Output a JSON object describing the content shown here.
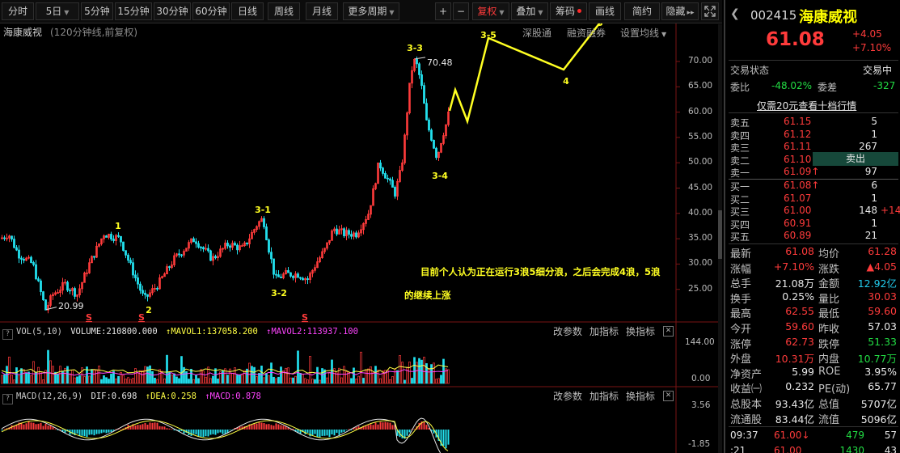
{
  "toolbar": {
    "tabs": [
      "分时",
      "5日",
      "5分钟",
      "15分钟",
      "30分钟",
      "60分钟",
      "日线",
      "周线",
      "月线",
      "更多周期"
    ],
    "plus": "+",
    "minus": "−",
    "fuquan": "复权",
    "diejia": "叠加",
    "chouma": "筹码",
    "huaxian": "画线",
    "jianyue": "简约",
    "yincang": "隐藏"
  },
  "chart": {
    "stock_name": "海康威视",
    "period_label": "(120分钟线,前复权)",
    "links": [
      "深股通",
      "融资融券",
      "设置均线"
    ],
    "price_ticks": [
      "70.00",
      "65.00",
      "60.00",
      "55.00",
      "50.00",
      "45.00",
      "40.00",
      "35.00",
      "30.00",
      "25.00"
    ],
    "high_label": "70.48",
    "low_label": "20.99",
    "wave_labels": [
      "1",
      "2",
      "3-1",
      "3-2",
      "3-3",
      "3-4",
      "3-5",
      "4",
      "5"
    ],
    "s_markers": [
      "S",
      "S",
      "S"
    ],
    "annotation_line1": "目前个人认为正在运行3浪5细分浪，之后会完成4浪，5浪",
    "annotation_line2": "的继续上涨"
  },
  "volume": {
    "legend_name": "VOL(5,10)",
    "volume": "VOLUME:210800.000",
    "mavol1": "MAVOL1:137058.200",
    "mavol2": "MAVOL2:113937.100",
    "ticks": [
      "144.00",
      "0.00"
    ],
    "btn_params": "改参数",
    "btn_add": "加指标",
    "btn_swap": "换指标"
  },
  "macd": {
    "legend_name": "MACD(12,26,9)",
    "dif": "DIF:0.698",
    "dea": "DEA:0.258",
    "macd": "MACD:0.878",
    "ticks": [
      "3.56",
      "-1.85"
    ],
    "btn_params": "改参数",
    "btn_add": "加指标",
    "btn_swap": "换指标"
  },
  "quote": {
    "code": "002415",
    "name": "海康威视",
    "price": "61.08",
    "change": "+4.05",
    "change_pct": "+7.10%",
    "trade_status_label": "交易状态",
    "trade_status": "交易中",
    "weibi_label": "委比",
    "weibi": "-48.02%",
    "weicha_label": "委差",
    "weicha": "-327",
    "l2_link": "仅需20元查看十档行情",
    "sell_btn": "卖出",
    "asks": [
      {
        "label": "卖五",
        "price": "61.15",
        "vol": "5",
        "extra": ""
      },
      {
        "label": "卖四",
        "price": "61.12",
        "vol": "1",
        "extra": ""
      },
      {
        "label": "卖三",
        "price": "61.11",
        "vol": "267",
        "extra": ""
      },
      {
        "label": "卖二",
        "price": "61.10",
        "vol": "",
        "extra": ""
      },
      {
        "label": "卖一",
        "price": "61.09↑",
        "vol": "97",
        "extra": ""
      }
    ],
    "bids": [
      {
        "label": "买一",
        "price": "61.08↑",
        "vol": "6",
        "extra": ""
      },
      {
        "label": "买二",
        "price": "61.07",
        "vol": "1",
        "extra": ""
      },
      {
        "label": "买三",
        "price": "61.00",
        "vol": "148",
        "extra": "+147"
      },
      {
        "label": "买四",
        "price": "60.91",
        "vol": "1",
        "extra": ""
      },
      {
        "label": "买五",
        "price": "60.89",
        "vol": "21",
        "extra": ""
      }
    ],
    "stats": [
      {
        "l1": "最新",
        "v1": "61.08",
        "c1": "red",
        "l2": "均价",
        "v2": "61.28",
        "c2": "red"
      },
      {
        "l1": "涨幅",
        "v1": "+7.10%",
        "c1": "red",
        "l2": "涨跌",
        "v2": "▲4.05",
        "c2": "red"
      },
      {
        "l1": "总手",
        "v1": "21.08万",
        "c1": "white",
        "l2": "金额",
        "v2": "12.92亿",
        "c2": "cyan"
      },
      {
        "l1": "换手",
        "v1": "0.25%",
        "c1": "white",
        "l2": "量比",
        "v2": "30.03",
        "c2": "red"
      },
      {
        "l1": "最高",
        "v1": "62.55",
        "c1": "red",
        "l2": "最低",
        "v2": "59.60",
        "c2": "red"
      },
      {
        "l1": "今开",
        "v1": "59.60",
        "c1": "red",
        "l2": "昨收",
        "v2": "57.03",
        "c2": "white"
      },
      {
        "l1": "涨停",
        "v1": "62.73",
        "c1": "red",
        "l2": "跌停",
        "v2": "51.33",
        "c2": "green"
      },
      {
        "l1": "外盘",
        "v1": "10.31万",
        "c1": "red",
        "l2": "内盘",
        "v2": "10.77万",
        "c2": "green"
      },
      {
        "l1": "净资产",
        "v1": "5.99",
        "c1": "white",
        "l2": "ROE",
        "v2": "3.95%",
        "c2": "white"
      },
      {
        "l1": "收益㈠",
        "v1": "0.232",
        "c1": "white",
        "l2": "PE(动)",
        "v2": "65.77",
        "c2": "white"
      },
      {
        "l1": "总股本",
        "v1": "93.43亿",
        "c1": "white",
        "l2": "总值",
        "v2": "5707亿",
        "c2": "white"
      },
      {
        "l1": "流通股",
        "v1": "83.44亿",
        "c1": "white",
        "l2": "流值",
        "v2": "5096亿",
        "c2": "white"
      }
    ],
    "ticks": [
      {
        "time": "09:37",
        "price": "61.00↓",
        "vol": "479",
        "n": "57"
      },
      {
        "time": ":21",
        "price": "61.00",
        "vol": "1430",
        "n": "43"
      }
    ]
  },
  "colors": {
    "up": "#ff3b3b",
    "down": "#22e0ee",
    "annot": "#ffff22",
    "bg": "#000000"
  }
}
